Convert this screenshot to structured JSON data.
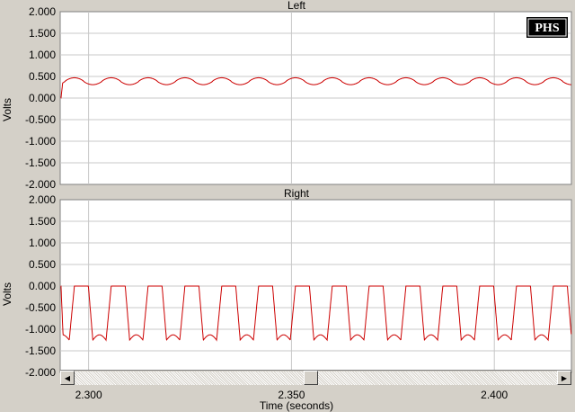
{
  "badge": "PHS",
  "colors": {
    "trace": "#cc0000",
    "grid": "#c8c8c8",
    "background": "#d4d0c8",
    "plot": "#ffffff"
  },
  "scrollbar": {
    "left_icon": "arrow-left-icon",
    "right_icon": "arrow-right-icon",
    "thumb_position": 0.49
  },
  "chart_data": [
    {
      "type": "line",
      "title": "Left",
      "ylabel": "Volts",
      "xlabel": "",
      "xlim": [
        2.293,
        2.419
      ],
      "ylim": [
        -2.0,
        2.0
      ],
      "xticks": [
        2.3,
        2.35,
        2.4
      ],
      "yticks": [
        "2.000",
        "1.500",
        "1.000",
        "0.500",
        "0.000",
        "-0.500",
        "-1.000",
        "-1.500",
        "-2.000"
      ],
      "grid": true,
      "waveform": {
        "shape": "ripple",
        "period": 0.00908,
        "phase": 2.2965,
        "min": 0.31,
        "max": 0.47,
        "start_value": 0.0
      }
    },
    {
      "type": "line",
      "title": "Right",
      "ylabel": "Volts",
      "xlabel": "Time (seconds)",
      "xlim": [
        2.293,
        2.419
      ],
      "ylim": [
        -2.0,
        2.0
      ],
      "xticks": [
        2.3,
        2.35,
        2.4
      ],
      "xticklabels": [
        "2.300",
        "2.350",
        "2.400"
      ],
      "yticks": [
        "2.000",
        "1.500",
        "1.000",
        "0.500",
        "0.000",
        "-0.500",
        "-1.000",
        "-1.500",
        "-2.000"
      ],
      "grid": true,
      "waveform": {
        "shape": "clipped",
        "period": 0.00908,
        "phase": 2.2965,
        "min": -1.25,
        "max": 0.0,
        "start_value": 0.0
      }
    }
  ]
}
